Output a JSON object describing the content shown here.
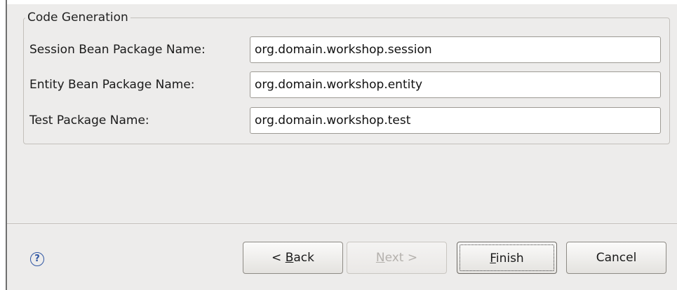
{
  "group": {
    "title": "Code Generation"
  },
  "fields": [
    {
      "label": "Session Bean Package Name:",
      "value": "org.domain.workshop.session"
    },
    {
      "label": "Entity Bean Package Name:",
      "value": "org.domain.workshop.entity"
    },
    {
      "label": "Test Package Name:",
      "value": "org.domain.workshop.test"
    }
  ],
  "help": {
    "icon": "help-icon",
    "glyph": "?"
  },
  "buttons": {
    "back": {
      "prefix": "< ",
      "mnemonic": "B",
      "rest": "ack",
      "enabled": true
    },
    "next": {
      "prefix": "",
      "mnemonic": "N",
      "rest": "ext >",
      "enabled": false
    },
    "finish": {
      "prefix": "",
      "mnemonic": "F",
      "rest": "inish",
      "enabled": true,
      "default": true
    },
    "cancel": {
      "label": "Cancel",
      "enabled": true
    }
  },
  "colors": {
    "dialog_background": "#edeceb",
    "help_accent": "#2f56a3",
    "disabled_text": "#b4b1ad"
  }
}
